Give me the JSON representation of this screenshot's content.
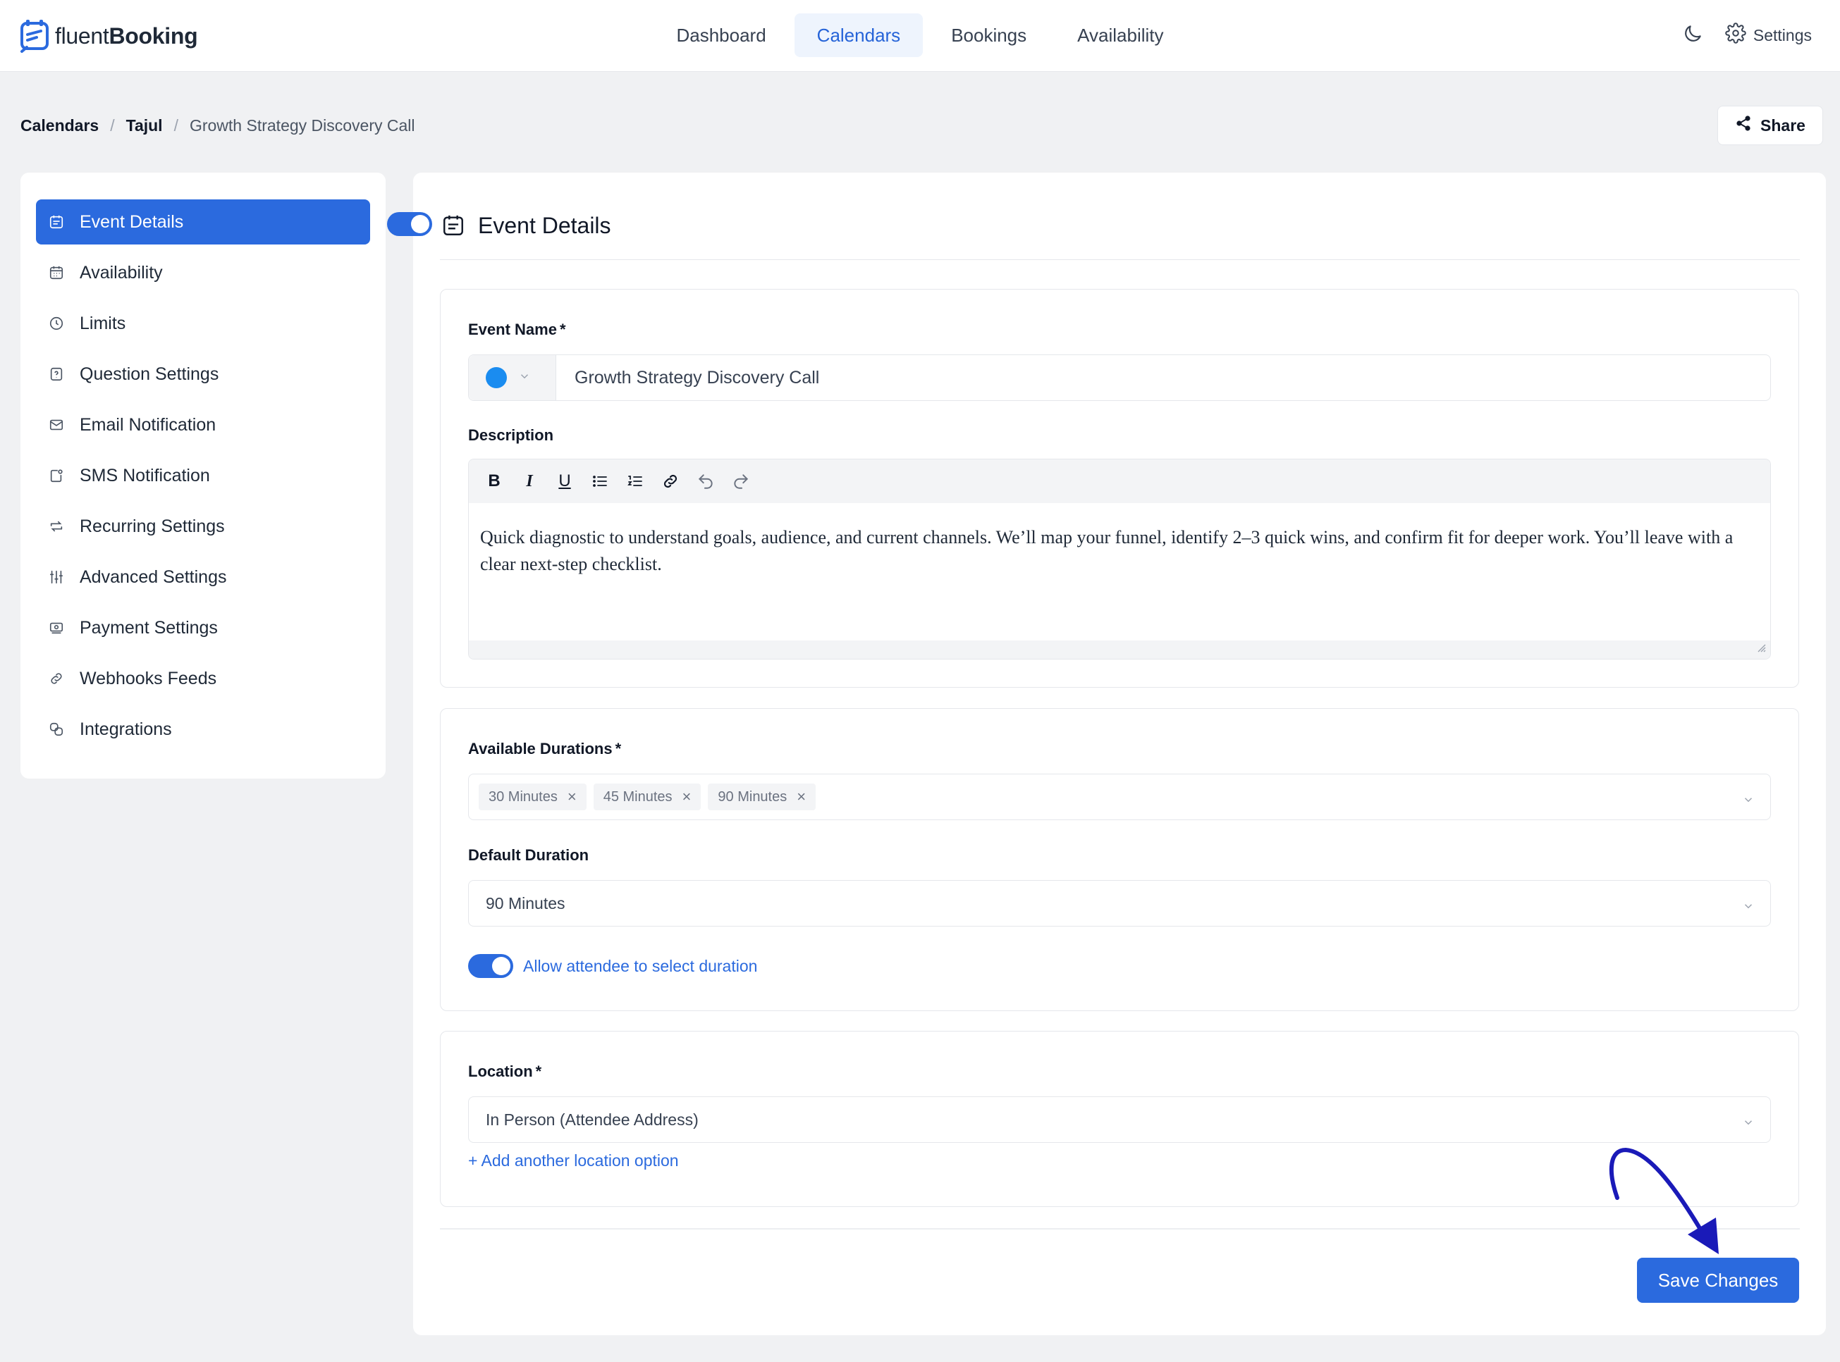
{
  "brand": {
    "name_light": "fluent",
    "name_bold": "Booking"
  },
  "nav": {
    "items": [
      {
        "label": "Dashboard",
        "active": false
      },
      {
        "label": "Calendars",
        "active": true
      },
      {
        "label": "Bookings",
        "active": false
      },
      {
        "label": "Availability",
        "active": false
      }
    ],
    "settings_label": "Settings"
  },
  "breadcrumb": {
    "root": "Calendars",
    "calendar": "Tajul",
    "current": "Growth Strategy Discovery Call",
    "separator": "/"
  },
  "share_label": "Share",
  "sidebar": {
    "items": [
      {
        "label": "Event Details",
        "icon": "event-icon"
      },
      {
        "label": "Availability",
        "icon": "calendar-icon"
      },
      {
        "label": "Limits",
        "icon": "clock-icon"
      },
      {
        "label": "Question Settings",
        "icon": "question-icon"
      },
      {
        "label": "Email Notification",
        "icon": "mail-icon"
      },
      {
        "label": "SMS Notification",
        "icon": "sms-icon"
      },
      {
        "label": "Recurring Settings",
        "icon": "repeat-icon"
      },
      {
        "label": "Advanced Settings",
        "icon": "sliders-icon"
      },
      {
        "label": "Payment Settings",
        "icon": "payment-icon"
      },
      {
        "label": "Webhooks Feeds",
        "icon": "link-icon"
      },
      {
        "label": "Integrations",
        "icon": "integrations-icon"
      }
    ]
  },
  "main": {
    "title": "Event Details",
    "enabled": true,
    "event_name": {
      "label": "Event Name",
      "required_mark": "*",
      "color": "#1a8cf0",
      "value": "Growth Strategy Discovery Call"
    },
    "description": {
      "label": "Description",
      "text": "Quick diagnostic to understand goals, audience, and current channels. We’ll map your funnel, identify 2–3 quick wins, and confirm fit for deeper work. You’ll leave with a clear next-step checklist."
    },
    "durations": {
      "label": "Available Durations",
      "required_mark": "*",
      "tags": [
        "30 Minutes",
        "45 Minutes",
        "90 Minutes"
      ],
      "tag_remove": "×"
    },
    "default_duration": {
      "label": "Default Duration",
      "value": "90 Minutes"
    },
    "allow_select": {
      "label": "Allow attendee to select duration",
      "on": true
    },
    "location": {
      "label": "Location",
      "required_mark": "*",
      "value": "In Person (Attendee Address)",
      "add_link": "+ Add another location option"
    },
    "save_label": "Save Changes"
  },
  "colors": {
    "accent": "#2b6ade",
    "background": "#f0f1f3",
    "annotation": "#1a1ab8"
  }
}
